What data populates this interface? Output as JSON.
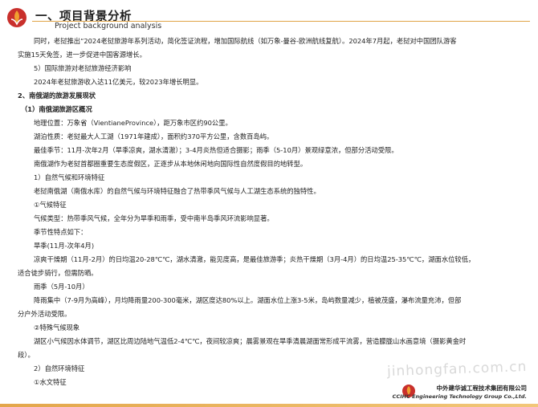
{
  "header": {
    "title": "一、项目背景分析",
    "subtitle": "Project background analysis"
  },
  "paragraphs": {
    "p1_a": "同时，老挝推出“2024老挝旅游年系列活动，简化签证流程，增加国际航线（如万象-曼谷-欧洲航线复航）。2024年7月起，老挝对中国团队游客",
    "p1_b": "实施15天免签，进一步促进中国客源增长。",
    "l5": "5）国际旅游对老挝旅游经济影响",
    "l6": "2024年老挝旅游收入达11亿美元，较2023年增长明显。",
    "s2": "2、南俄湖的旅游发展现状",
    "s2_1": "（1）南俄湖旅游区概况",
    "geo": "地理位置：万象省（VientianeProvince），距万象市区约90公里。",
    "lake": "湖泊性质：老挝最大人工湖（1971年建成），面积约370平方公里，含数百岛屿。",
    "season": "最佳季节：11月-次年2月（旱季凉爽，湖水清澈）；3-4月炎热但适合摄影；雨季（5-10月）景观绿意浓，但部分活动受限。",
    "plan": "南俄湖作为老挝首都圈重要生态度假区，正逐步从本地休闲地向国际性自然度假目的地转型。",
    "n1": "1）自然气候和环境特征",
    "climate_intro": "老挝南俄湖（南俄水库）的自然气候与环境特征融合了热带季风气候与人工湖生态系统的独特性。",
    "c1": "①气候特征",
    "climate_type": "气候类型：热带季风气候，全年分为旱季和雨季，受中南半岛季风环流影响显著。",
    "season_feat": "季节性特点如下：",
    "dry": "旱季(11月-次年4月)",
    "dry_desc_a": "凉爽干燥期（11月-2月）的日均温20-28℃℃，湖水清澈，能见度高，是最佳旅游季；炎热干燥期（3月-4月）的日均温25-35℃℃，湖面水位较低，",
    "dry_desc_b": "适合徒步骑行，但需防晒。",
    "rain": "雨季（5月-10月）",
    "rain_desc_a": "降雨集中（7-9月为高峰），月均降雨量200-300毫米，湖区度达80%以上。湖面水位上涨3-5米，岛屿数量减少，植被茂盛，瀑布流量充沛，但部",
    "rain_desc_b": "分户外活动受限。",
    "c2": "②特殊气候现象",
    "micro_a": "湖区小气候因水体调节，湖区比周边陆地气温低2-4℃℃，夜间较凉爽；晨雾景观在旱季清晨湖面常形成平流雾，营造朦胧山水画意境（摄影黄金时",
    "micro_b": "段）。",
    "n2": "2）自然环境特征",
    "c3": "①水文特征"
  },
  "watermark": "jinhongfan.com.cn",
  "footer": {
    "company_cn": "中外建华诚工程技术集团有限公司",
    "company_en": "CCIHC Engineering Technology Group Co.,Ltd."
  },
  "colors": {
    "accent": "#e0a347",
    "logo_red": "#c9302c",
    "logo_orange": "#f0a030"
  }
}
